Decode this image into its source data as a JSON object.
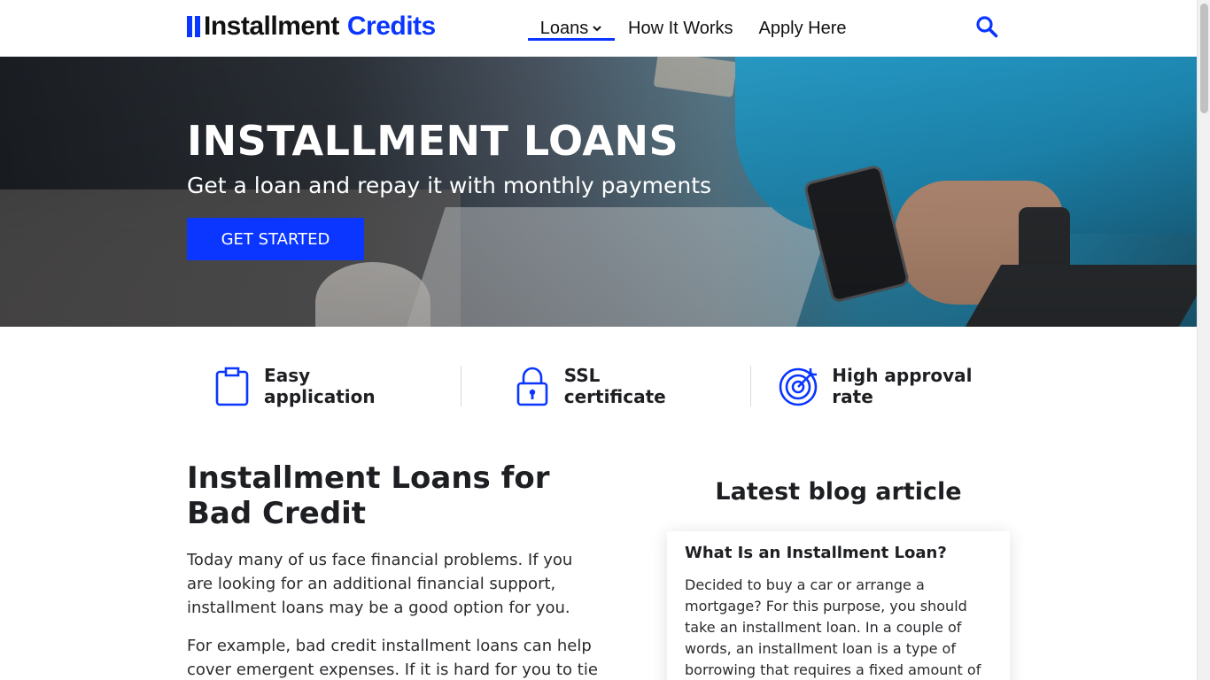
{
  "header": {
    "logo": {
      "word1": "Installment",
      "word2": "Credits"
    },
    "nav": {
      "loans": "Loans",
      "how_it_works": "How It Works",
      "apply_here": "Apply Here"
    },
    "search_icon": "search-icon"
  },
  "hero": {
    "title": "INSTALLMENT LOANS",
    "subtitle": "Get a loan and repay it with monthly payments",
    "cta": "GET STARTED"
  },
  "features": [
    {
      "icon": "clipboard-icon",
      "label": "Easy application"
    },
    {
      "icon": "lock-icon",
      "label": "SSL certificate"
    },
    {
      "icon": "target-icon",
      "label": "High approval rate"
    }
  ],
  "article": {
    "title": "Installment Loans for Bad Credit",
    "paragraph1": "Today many of us face financial problems. If you are looking for an additional financial support, installment loans may be a good option for you.",
    "paragraph2": "For example, bad credit installment loans can help cover emergent expenses. If it is hard for you to tie"
  },
  "blog": {
    "heading": "Latest blog article",
    "card_title": "What Is an Installment Loan?",
    "card_text": "Decided to buy a car or arrange a mortgage? For this purpose, you should take an installment loan. In a couple of words, an installment loan is a type of borrowing that requires a fixed amount of payment each"
  },
  "colors": {
    "accent": "#0a36ff",
    "text": "#1e1f22"
  }
}
